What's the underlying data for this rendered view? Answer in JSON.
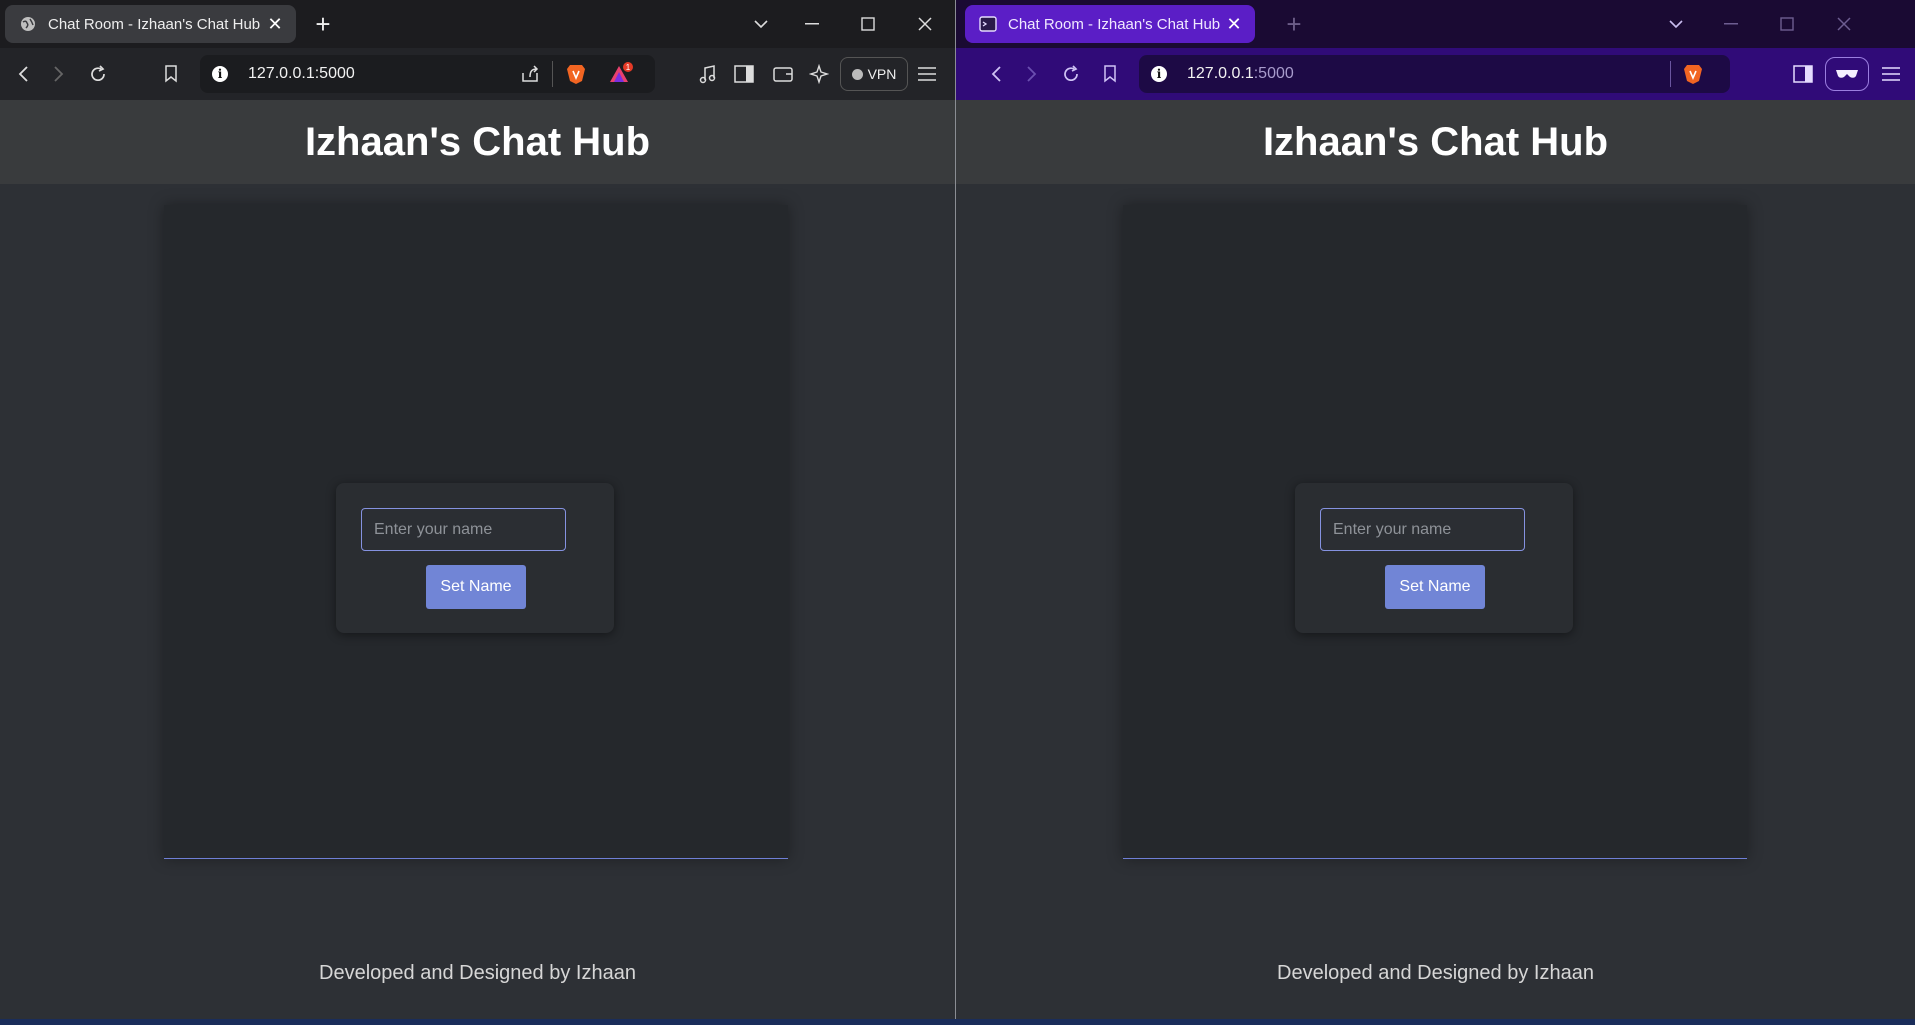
{
  "windows": [
    {
      "id": "left",
      "tab": {
        "title": "Chat Room - Izhaan's Chat Hub",
        "favicon": "globe-icon"
      },
      "address": {
        "host": "127.0.0.1",
        "port": ":5000"
      },
      "vpn_label": "VPN",
      "notification_badge": "1",
      "accent": "#3a3b3f"
    },
    {
      "id": "right",
      "tab": {
        "title": "Chat Room - Izhaan's Chat Hub",
        "favicon": "terminal-icon"
      },
      "address": {
        "host": "127.0.0.1",
        "port": ":5000"
      },
      "accent": "#5b1ec6"
    }
  ],
  "page": {
    "title": "Izhaan's Chat Hub",
    "name_input_placeholder": "Enter your name",
    "set_name_button": "Set Name",
    "footer": "Developed and Designed by Izhaan"
  },
  "colors": {
    "page_bg": "#2d3035",
    "header_bg": "#393b3d",
    "button": "#7185d6",
    "private_toolbar": "#300b78"
  }
}
